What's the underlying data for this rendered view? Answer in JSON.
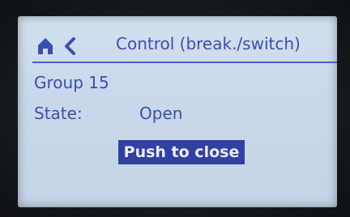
{
  "header": {
    "title": "Control (break./switch)",
    "home_icon": "home-icon",
    "back_icon": "chevron-left-icon"
  },
  "info": {
    "group": "Group 15",
    "state_label": "State:",
    "state_value": "Open"
  },
  "action": {
    "button_label": "Push to close"
  },
  "colors": {
    "screen_bg": "#cddceb",
    "text": "#3b4fae",
    "rule": "#4a5ec6",
    "button_bg": "#3240a1",
    "button_text": "#e6ecff"
  }
}
